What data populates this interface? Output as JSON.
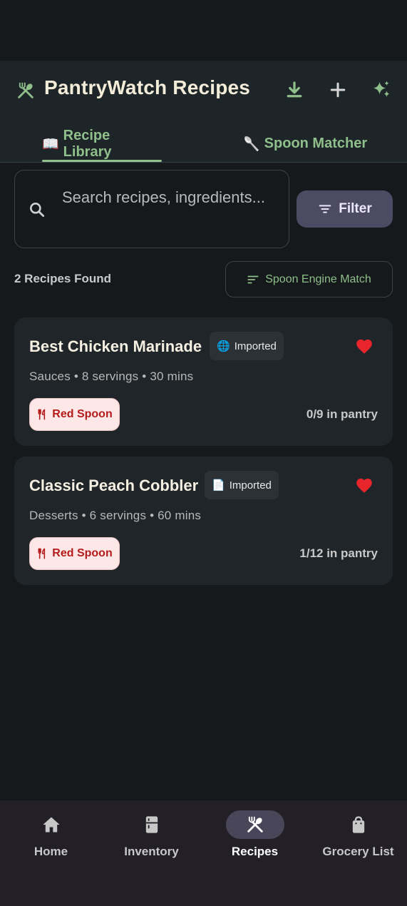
{
  "header": {
    "title": "PantryWatch Recipes",
    "logo_icon": "fork-spoon-icon",
    "actions": [
      "download-icon",
      "add-icon",
      "sparkles-icon"
    ]
  },
  "tabs": [
    {
      "glyph": "📖",
      "label": "Recipe Library",
      "active": true
    },
    {
      "glyph": "🥄",
      "label": "Spoon Matcher",
      "active": false
    }
  ],
  "search": {
    "placeholder": "Search recipes, ingredients..."
  },
  "filter": {
    "label": "Filter"
  },
  "results": {
    "count_label": "2 Recipes Found",
    "sort_label": "Spoon Engine Match"
  },
  "recipes": [
    {
      "title": "Best Chicken Marinade",
      "import_glyph": "🌐",
      "import_label": "Imported",
      "favorite": true,
      "meta": "Sauces • 8 servings • 30 mins",
      "spoon_label": "Red Spoon",
      "pantry": "0/9 in pantry"
    },
    {
      "title": "Classic Peach Cobbler",
      "import_glyph": "📄",
      "import_label": "Imported",
      "favorite": true,
      "meta": "Desserts • 6 servings • 60 mins",
      "spoon_label": "Red Spoon",
      "pantry": "1/12 in pantry"
    }
  ],
  "nav": [
    {
      "label": "Home",
      "icon": "home-icon",
      "active": false
    },
    {
      "label": "Inventory",
      "icon": "fridge-icon",
      "active": false
    },
    {
      "label": "Recipes",
      "icon": "fork-spoon-icon",
      "active": true
    },
    {
      "label": "Grocery List",
      "icon": "shopping-bag-icon",
      "active": false
    }
  ],
  "colors": {
    "accent": "#8fbf8a",
    "title": "#f3ecd8",
    "heart": "#e8252b",
    "spoon_badge_bg": "#fde7e7",
    "spoon_badge_text": "#b41b1b"
  }
}
